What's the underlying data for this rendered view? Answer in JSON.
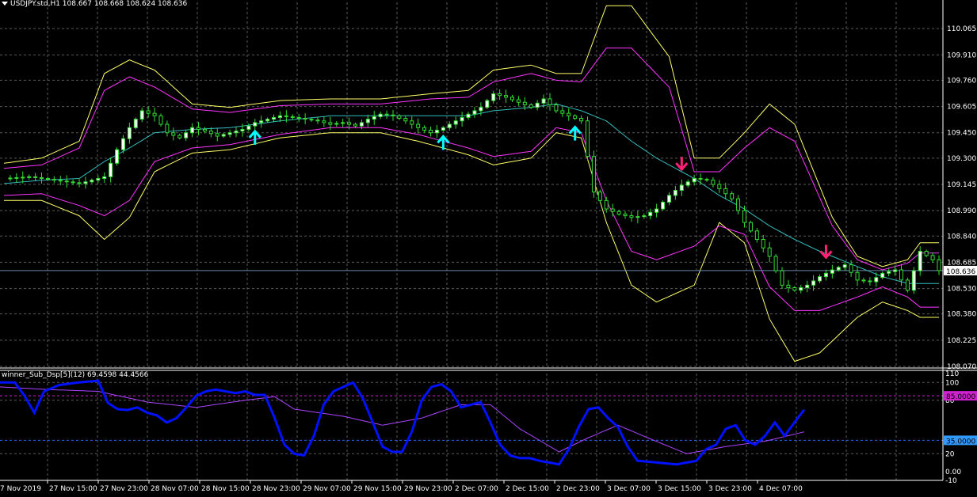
{
  "main_chart": {
    "title": "USDJPY.std,H1  108.667 108.668 108.624 108.636",
    "current_price_label": "108.636",
    "price_axis_labels": [
      "110.065",
      "109.910",
      "109.760",
      "109.605",
      "109.450",
      "109.300",
      "109.145",
      "108.990",
      "108.840",
      "108.685",
      "108.530",
      "108.380",
      "108.225",
      "108.070"
    ]
  },
  "sub_chart": {
    "title": "winner_Sub_Dsp[5](12) 69.4598 44.4566",
    "axis_labels": [
      "110",
      "100",
      "80",
      "20",
      "0.00",
      "-10"
    ],
    "level_high_label": "85.0000",
    "level_low_label": "35.0000"
  },
  "time_axis_labels": [
    "7 Nov 2019",
    "27 Nov 15:00",
    "27 Nov 23:00",
    "28 Nov 07:00",
    "28 Nov 15:00",
    "28 Nov 23:00",
    "29 Nov 07:00",
    "29 Nov 15:00",
    "29 Nov 23:00",
    "2 Dec 07:00",
    "2 Dec 15:00",
    "2 Dec 23:00",
    "3 Dec 07:00",
    "3 Dec 15:00",
    "3 Dec 23:00",
    "4 Dec 07:00"
  ],
  "colors": {
    "background": "#000000",
    "grid": "#5a5a5a",
    "axis_text": "#ffffff",
    "candle": "#33dd33",
    "bull_body": "#ffffff",
    "band_outer": "#ffff66",
    "band_mid": "#ff33ff",
    "band_inner": "#33bbbb",
    "osc_main": "#0011ff",
    "osc_signal": "#aa44ff",
    "level_high": "#cc22cc",
    "level_low": "#2266ff",
    "arrow_up": "#00ffff",
    "arrow_down": "#ff2277"
  },
  "chart_data": {
    "type": "candlestick",
    "symbol": "USDJPY",
    "timeframe": "H1",
    "ylim": [
      108.07,
      110.22
    ],
    "last_price": 108.636,
    "close_path": [
      [
        0,
        109.18
      ],
      [
        4,
        109.19
      ],
      [
        8,
        109.17
      ],
      [
        12,
        109.15
      ],
      [
        16,
        109.19
      ],
      [
        18,
        109.35
      ],
      [
        20,
        109.48
      ],
      [
        22,
        109.58
      ],
      [
        24,
        109.55
      ],
      [
        26,
        109.45
      ],
      [
        28,
        109.42
      ],
      [
        30,
        109.48
      ],
      [
        32,
        109.46
      ],
      [
        34,
        109.43
      ],
      [
        36,
        109.45
      ],
      [
        38,
        109.47
      ],
      [
        40,
        109.51
      ],
      [
        42,
        109.53
      ],
      [
        44,
        109.55
      ],
      [
        46,
        109.54
      ],
      [
        48,
        109.53
      ],
      [
        50,
        109.52
      ],
      [
        52,
        109.5
      ],
      [
        54,
        109.51
      ],
      [
        56,
        109.49
      ],
      [
        58,
        109.53
      ],
      [
        60,
        109.56
      ],
      [
        62,
        109.55
      ],
      [
        64,
        109.52
      ],
      [
        66,
        109.48
      ],
      [
        68,
        109.45
      ],
      [
        70,
        109.48
      ],
      [
        72,
        109.52
      ],
      [
        74,
        109.56
      ],
      [
        76,
        109.6
      ],
      [
        78,
        109.68
      ],
      [
        80,
        109.66
      ],
      [
        82,
        109.63
      ],
      [
        84,
        109.6
      ],
      [
        86,
        109.65
      ],
      [
        88,
        109.58
      ],
      [
        90,
        109.55
      ],
      [
        92,
        109.52
      ],
      [
        94,
        109.1
      ],
      [
        96,
        109.0
      ],
      [
        98,
        108.97
      ],
      [
        100,
        108.95
      ],
      [
        102,
        108.96
      ],
      [
        104,
        109.0
      ],
      [
        106,
        109.08
      ],
      [
        108,
        109.14
      ],
      [
        110,
        109.18
      ],
      [
        112,
        109.17
      ],
      [
        114,
        109.12
      ],
      [
        116,
        109.06
      ],
      [
        118,
        108.92
      ],
      [
        120,
        108.82
      ],
      [
        122,
        108.72
      ],
      [
        124,
        108.55
      ],
      [
        126,
        108.52
      ],
      [
        128,
        108.55
      ],
      [
        130,
        108.6
      ],
      [
        132,
        108.64
      ],
      [
        134,
        108.67
      ],
      [
        136,
        108.58
      ],
      [
        138,
        108.57
      ],
      [
        140,
        108.62
      ],
      [
        142,
        108.64
      ],
      [
        144,
        108.52
      ],
      [
        146,
        108.75
      ],
      [
        148,
        108.7
      ],
      [
        149,
        108.636
      ]
    ],
    "bands": {
      "outer_upper": [
        [
          0,
          109.27
        ],
        [
          6,
          109.3
        ],
        [
          12,
          109.4
        ],
        [
          16,
          109.8
        ],
        [
          20,
          109.88
        ],
        [
          24,
          109.82
        ],
        [
          30,
          109.62
        ],
        [
          36,
          109.6
        ],
        [
          44,
          109.64
        ],
        [
          52,
          109.65
        ],
        [
          60,
          109.65
        ],
        [
          68,
          109.68
        ],
        [
          74,
          109.7
        ],
        [
          78,
          109.82
        ],
        [
          84,
          109.85
        ],
        [
          88,
          109.8
        ],
        [
          92,
          109.8
        ],
        [
          96,
          110.2
        ],
        [
          100,
          110.2
        ],
        [
          106,
          109.9
        ],
        [
          110,
          109.3
        ],
        [
          114,
          109.3
        ],
        [
          118,
          109.45
        ],
        [
          122,
          109.62
        ],
        [
          126,
          109.5
        ],
        [
          132,
          108.95
        ],
        [
          136,
          108.72
        ],
        [
          140,
          108.66
        ],
        [
          144,
          108.7
        ],
        [
          146,
          108.8
        ],
        [
          149,
          108.8
        ]
      ],
      "outer_lower": [
        [
          0,
          109.05
        ],
        [
          6,
          109.05
        ],
        [
          12,
          108.96
        ],
        [
          16,
          108.82
        ],
        [
          20,
          108.95
        ],
        [
          24,
          109.22
        ],
        [
          30,
          109.33
        ],
        [
          36,
          109.35
        ],
        [
          44,
          109.42
        ],
        [
          52,
          109.45
        ],
        [
          60,
          109.45
        ],
        [
          66,
          109.4
        ],
        [
          74,
          109.32
        ],
        [
          78,
          109.26
        ],
        [
          84,
          109.3
        ],
        [
          88,
          109.45
        ],
        [
          92,
          109.42
        ],
        [
          96,
          108.92
        ],
        [
          100,
          108.55
        ],
        [
          104,
          108.45
        ],
        [
          110,
          108.55
        ],
        [
          114,
          108.92
        ],
        [
          118,
          108.8
        ],
        [
          122,
          108.35
        ],
        [
          126,
          108.1
        ],
        [
          130,
          108.15
        ],
        [
          136,
          108.36
        ],
        [
          140,
          108.45
        ],
        [
          144,
          108.4
        ],
        [
          146,
          108.36
        ],
        [
          149,
          108.36
        ]
      ],
      "mid_upper": [
        [
          0,
          109.24
        ],
        [
          6,
          109.26
        ],
        [
          12,
          109.36
        ],
        [
          16,
          109.7
        ],
        [
          20,
          109.78
        ],
        [
          24,
          109.72
        ],
        [
          30,
          109.59
        ],
        [
          36,
          109.57
        ],
        [
          44,
          109.61
        ],
        [
          52,
          109.62
        ],
        [
          60,
          109.62
        ],
        [
          68,
          109.65
        ],
        [
          74,
          109.66
        ],
        [
          78,
          109.75
        ],
        [
          84,
          109.8
        ],
        [
          88,
          109.76
        ],
        [
          92,
          109.75
        ],
        [
          96,
          109.95
        ],
        [
          100,
          109.95
        ],
        [
          106,
          109.72
        ],
        [
          110,
          109.22
        ],
        [
          114,
          109.22
        ],
        [
          118,
          109.36
        ],
        [
          122,
          109.48
        ],
        [
          126,
          109.4
        ],
        [
          132,
          108.9
        ],
        [
          136,
          108.7
        ],
        [
          140,
          108.64
        ],
        [
          144,
          108.68
        ],
        [
          146,
          108.74
        ],
        [
          149,
          108.74
        ]
      ],
      "mid_lower": [
        [
          0,
          109.08
        ],
        [
          6,
          109.09
        ],
        [
          12,
          109.02
        ],
        [
          16,
          108.96
        ],
        [
          20,
          109.05
        ],
        [
          24,
          109.28
        ],
        [
          30,
          109.36
        ],
        [
          36,
          109.38
        ],
        [
          44,
          109.44
        ],
        [
          52,
          109.48
        ],
        [
          60,
          109.48
        ],
        [
          66,
          109.44
        ],
        [
          74,
          109.36
        ],
        [
          78,
          109.31
        ],
        [
          84,
          109.34
        ],
        [
          88,
          109.48
        ],
        [
          92,
          109.45
        ],
        [
          96,
          109.05
        ],
        [
          100,
          108.75
        ],
        [
          104,
          108.7
        ],
        [
          110,
          108.78
        ],
        [
          114,
          108.9
        ],
        [
          118,
          108.85
        ],
        [
          122,
          108.54
        ],
        [
          126,
          108.4
        ],
        [
          130,
          108.4
        ],
        [
          136,
          108.48
        ],
        [
          140,
          108.54
        ],
        [
          144,
          108.48
        ],
        [
          146,
          108.42
        ],
        [
          149,
          108.42
        ]
      ],
      "center": [
        [
          0,
          109.15
        ],
        [
          6,
          109.17
        ],
        [
          12,
          109.18
        ],
        [
          16,
          109.28
        ],
        [
          20,
          109.36
        ],
        [
          24,
          109.45
        ],
        [
          30,
          109.47
        ],
        [
          36,
          109.48
        ],
        [
          44,
          109.52
        ],
        [
          52,
          109.55
        ],
        [
          60,
          109.55
        ],
        [
          66,
          109.55
        ],
        [
          74,
          109.55
        ],
        [
          78,
          109.58
        ],
        [
          84,
          109.6
        ],
        [
          88,
          109.62
        ],
        [
          92,
          109.58
        ],
        [
          96,
          109.52
        ],
        [
          100,
          109.4
        ],
        [
          104,
          109.3
        ],
        [
          110,
          109.18
        ],
        [
          114,
          109.08
        ],
        [
          118,
          109.0
        ],
        [
          122,
          108.9
        ],
        [
          126,
          108.82
        ],
        [
          130,
          108.75
        ],
        [
          136,
          108.66
        ],
        [
          140,
          108.6
        ],
        [
          144,
          108.56
        ],
        [
          146,
          108.56
        ],
        [
          149,
          108.56
        ]
      ]
    },
    "signals": [
      {
        "type": "up",
        "bar": 40
      },
      {
        "type": "up",
        "bar": 70
      },
      {
        "type": "up",
        "bar": 91
      },
      {
        "type": "down",
        "bar": 108
      },
      {
        "type": "down",
        "bar": 131
      }
    ],
    "oscillator": {
      "name": "winner_Sub_Dsp[5](12)",
      "values": [
        69.4598,
        44.4566
      ],
      "ylim": [
        -10,
        110
      ],
      "levels": [
        85,
        35
      ],
      "main": [
        [
          0,
          100
        ],
        [
          3,
          100
        ],
        [
          5,
          85
        ],
        [
          7,
          66
        ],
        [
          9,
          90
        ],
        [
          12,
          97
        ],
        [
          16,
          100
        ],
        [
          20,
          102
        ],
        [
          22,
          77
        ],
        [
          24,
          70
        ],
        [
          26,
          69
        ],
        [
          28,
          72
        ],
        [
          30,
          66
        ],
        [
          32,
          63
        ],
        [
          34,
          55
        ],
        [
          36,
          60
        ],
        [
          38,
          72
        ],
        [
          40,
          85
        ],
        [
          42,
          90
        ],
        [
          44,
          92
        ],
        [
          46,
          90
        ],
        [
          48,
          88
        ],
        [
          50,
          90
        ],
        [
          52,
          86
        ],
        [
          54,
          86
        ],
        [
          56,
          60
        ],
        [
          58,
          30
        ],
        [
          60,
          20
        ],
        [
          62,
          18
        ],
        [
          64,
          40
        ],
        [
          66,
          75
        ],
        [
          68,
          90
        ],
        [
          70,
          95
        ],
        [
          72,
          100
        ],
        [
          74,
          82
        ],
        [
          76,
          55
        ],
        [
          78,
          28
        ],
        [
          80,
          22
        ],
        [
          82,
          22
        ],
        [
          84,
          45
        ],
        [
          86,
          80
        ],
        [
          88,
          95
        ],
        [
          90,
          98
        ],
        [
          92,
          90
        ],
        [
          94,
          72
        ],
        [
          96,
          75
        ],
        [
          98,
          78
        ],
        [
          100,
          55
        ],
        [
          102,
          30
        ],
        [
          104,
          18
        ],
        [
          106,
          15
        ],
        [
          108,
          15
        ],
        [
          110,
          12
        ],
        [
          114,
          8
        ],
        [
          116,
          25
        ],
        [
          118,
          50
        ],
        [
          120,
          70
        ],
        [
          122,
          72
        ],
        [
          124,
          60
        ],
        [
          126,
          50
        ],
        [
          128,
          28
        ],
        [
          130,
          12
        ],
        [
          134,
          10
        ],
        [
          138,
          8
        ],
        [
          142,
          12
        ],
        [
          144,
          25
        ],
        [
          146,
          30
        ],
        [
          148,
          48
        ],
        [
          150,
          52
        ],
        [
          152,
          35
        ],
        [
          154,
          30
        ],
        [
          156,
          40
        ],
        [
          158,
          55
        ],
        [
          160,
          40
        ],
        [
          162,
          55
        ],
        [
          164,
          69.46
        ]
      ],
      "signal": [
        [
          0,
          95
        ],
        [
          10,
          92
        ],
        [
          20,
          90
        ],
        [
          30,
          78
        ],
        [
          40,
          72
        ],
        [
          50,
          80
        ],
        [
          56,
          84
        ],
        [
          60,
          70
        ],
        [
          70,
          62
        ],
        [
          78,
          52
        ],
        [
          86,
          60
        ],
        [
          94,
          75
        ],
        [
          100,
          75
        ],
        [
          106,
          48
        ],
        [
          114,
          22
        ],
        [
          120,
          38
        ],
        [
          126,
          52
        ],
        [
          132,
          38
        ],
        [
          140,
          20
        ],
        [
          148,
          28
        ],
        [
          156,
          34
        ],
        [
          164,
          44.46
        ]
      ]
    }
  }
}
